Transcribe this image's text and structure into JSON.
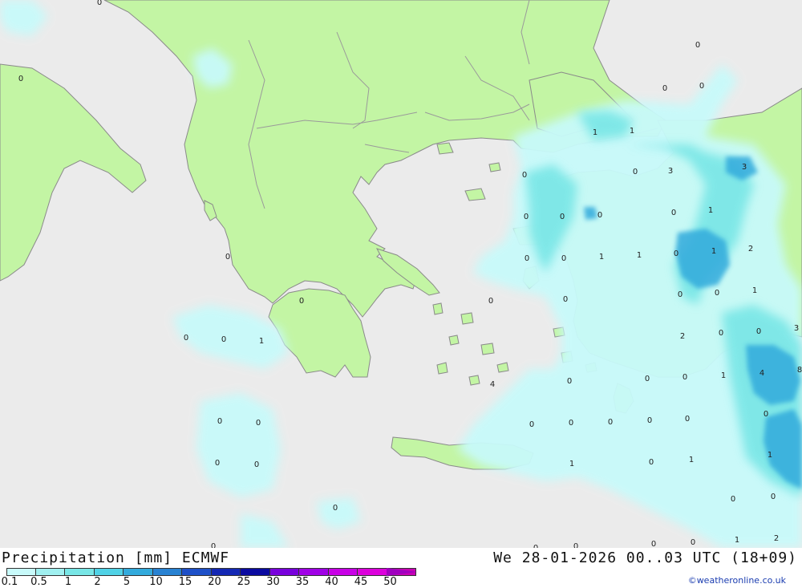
{
  "map": {
    "colors": {
      "sea": "#ebebeb",
      "land": "#c3f5a4",
      "border": "#9a9a9a",
      "coast": "#8a8a8a"
    },
    "values": [
      "0",
      "0",
      "0",
      "0",
      "0",
      "1",
      "1",
      "0",
      "0",
      "3",
      "3",
      "0",
      "0",
      "0",
      "0",
      "0",
      "1",
      "0",
      "0",
      "1",
      "1",
      "0",
      "1",
      "2",
      "0",
      "0",
      "0",
      "0",
      "0",
      "1",
      "0",
      "0",
      "1",
      "0",
      "2",
      "0",
      "3",
      "4",
      "0",
      "0",
      "0",
      "1",
      "4",
      "8",
      "0",
      "0",
      "0",
      "0",
      "0",
      "0",
      "0",
      "0",
      "0",
      "0",
      "1",
      "0",
      "1",
      "1",
      "0",
      "0",
      "0",
      "0",
      "0",
      "0",
      "0",
      "0",
      "1",
      "2"
    ]
  },
  "footer": {
    "title_left": "Precipitation [mm] ECMWF",
    "title_right": "We 28-01-2026 00..03 UTC (18+09)",
    "credit": "©weatheronline.co.uk",
    "legend": {
      "colors": [
        "#c8fafa",
        "#a0f0f0",
        "#78e6e6",
        "#50d2e6",
        "#32aadc",
        "#2882d2",
        "#1e50c8",
        "#1428b4",
        "#0a0aa0",
        "#7800dc",
        "#a000e6",
        "#c800e6",
        "#dc00dc",
        "#c800b4"
      ],
      "arrow_color": "#a000c0",
      "ticks": [
        "0.1",
        "0.5",
        "1",
        "2",
        "5",
        "10",
        "15",
        "20",
        "25",
        "30",
        "35",
        "40",
        "45",
        "50"
      ]
    }
  }
}
